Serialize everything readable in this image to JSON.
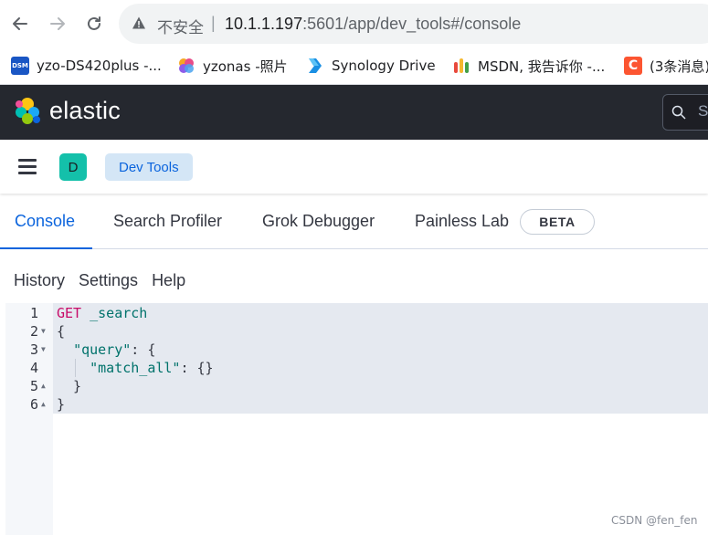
{
  "browser": {
    "security_label": "不安全",
    "url_host": "10.1.1.197",
    "url_rest": ":5601/app/dev_tools#/console",
    "bookmarks": [
      {
        "label": "yzo-DS420plus -...",
        "icon": "dsm-icon"
      },
      {
        "label": "yzonas -照片",
        "icon": "photos-icon"
      },
      {
        "label": "Synology Drive",
        "icon": "synology-drive-icon"
      },
      {
        "label": "MSDN, 我告诉你 -...",
        "icon": "msdn-icon"
      },
      {
        "label": "(3条消息)",
        "icon": "csdn-icon"
      }
    ],
    "colors": {
      "dsm": "#1a56c4",
      "csdn": "#fc5531",
      "drive": "#1a8fe3"
    }
  },
  "kibana": {
    "logo_text": "elastic",
    "space_initial": "D",
    "breadcrumb": "Dev Tools",
    "search_hint": "S",
    "tabs": [
      {
        "label": "Console",
        "active": true
      },
      {
        "label": "Search Profiler",
        "active": false
      },
      {
        "label": "Grok Debugger",
        "active": false
      },
      {
        "label": "Painless Lab",
        "active": false
      }
    ],
    "beta_badge": "BETA",
    "menu": [
      "History",
      "Settings",
      "Help"
    ],
    "colors": {
      "header_bg": "#25282f",
      "accent": "#0b64dd",
      "space_avatar": "#14c0aa"
    }
  },
  "editor": {
    "lines": [
      {
        "num": "1",
        "method": "GET",
        "url": "_search"
      },
      {
        "num": "2",
        "text": "{"
      },
      {
        "num": "3",
        "indent": "  ",
        "key": "\"query\"",
        "after": ": {"
      },
      {
        "num": "4",
        "indent": "    ",
        "key": "\"match_all\"",
        "after": ": {}"
      },
      {
        "num": "5",
        "text": "  }"
      },
      {
        "num": "6",
        "text": "}"
      }
    ]
  },
  "watermark": "CSDN @fen_fen"
}
